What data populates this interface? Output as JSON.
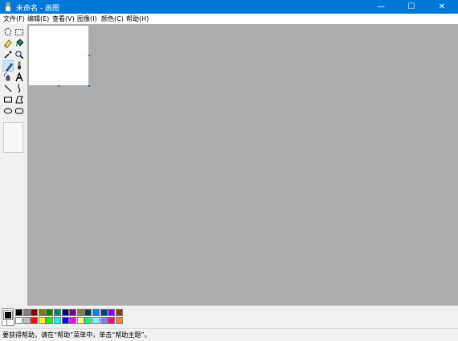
{
  "window": {
    "title": "未命名 - 画图",
    "controls": {
      "minimize": "—",
      "maximize": "☐",
      "close": "✕"
    }
  },
  "menubar": {
    "items": [
      "文件(F)",
      "编辑(E)",
      "查看(V)",
      "图像(I)",
      "颜色(C)",
      "帮助(H)"
    ]
  },
  "toolbox": {
    "tools": [
      "free-select",
      "rect-select",
      "eraser",
      "fill",
      "color-picker",
      "magnifier",
      "pencil",
      "brush",
      "airbrush",
      "text",
      "line",
      "curve",
      "rectangle",
      "polygon",
      "ellipse",
      "rounded-rectangle"
    ],
    "active_tool": "pencil"
  },
  "palette": {
    "foreground": "#000000",
    "background": "#ffffff",
    "colors_top": [
      "#000000",
      "#808080",
      "#800000",
      "#808000",
      "#008000",
      "#008080",
      "#000080",
      "#800080",
      "#808040",
      "#004040",
      "#0080ff",
      "#004080",
      "#8000ff",
      "#804000"
    ],
    "colors_bottom": [
      "#ffffff",
      "#c0c0c0",
      "#ff0000",
      "#ffff00",
      "#00ff00",
      "#00ffff",
      "#0000ff",
      "#ff00ff",
      "#ffff80",
      "#00ff80",
      "#80ffff",
      "#8080ff",
      "#ff0080",
      "#ff8040"
    ]
  },
  "status": {
    "text": "要获得帮助，请在“帮助”菜单中，单击“帮助主题”。"
  }
}
